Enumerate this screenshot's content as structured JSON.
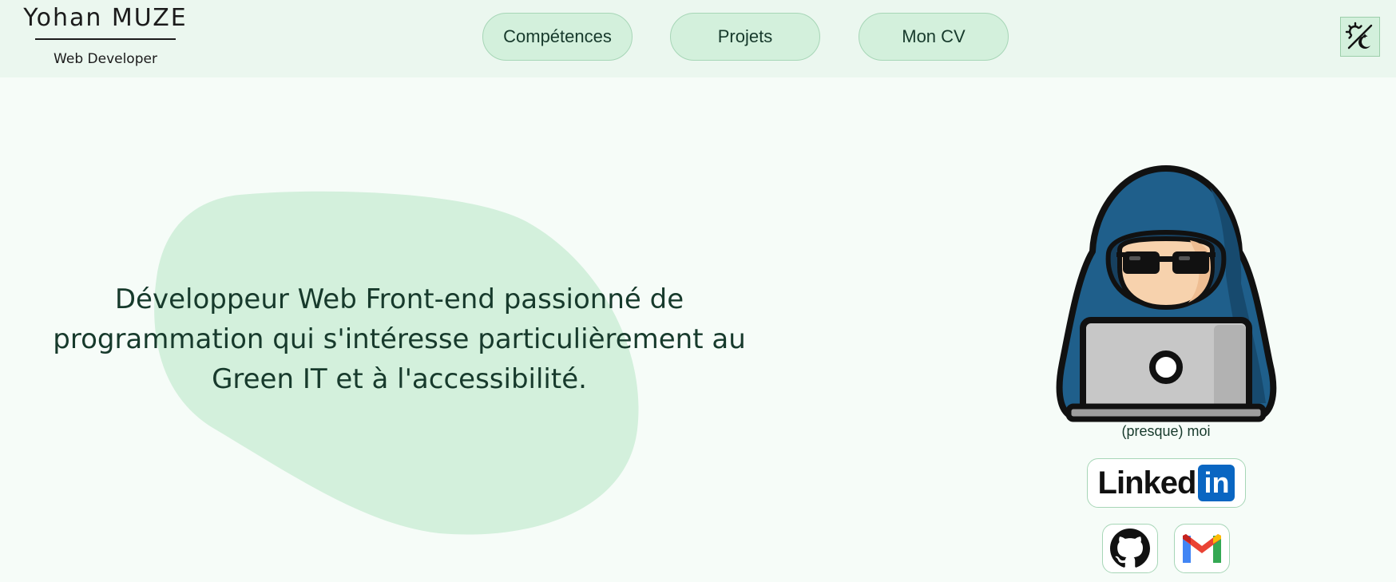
{
  "header": {
    "brand_name": "Yohan MUZE",
    "brand_role": "Web Developer",
    "nav": [
      {
        "label": "Compétences"
      },
      {
        "label": "Projets"
      },
      {
        "label": "Mon CV"
      }
    ],
    "theme_toggle_icon": "sun-moon-icon"
  },
  "hero": {
    "tagline_lines": [
      "Développeur Web Front-end passionné de",
      "programmation qui s'intéresse particulièrement au",
      "Green IT et à l'accessibilité."
    ],
    "avatar_caption": "(presque) moi"
  },
  "social": {
    "linkedin_word": "Linked",
    "linkedin_in": "in",
    "github_icon": "github-icon",
    "gmail_icon": "gmail-icon"
  },
  "colors": {
    "header_bg": "#ebf7ef",
    "page_bg": "#f6fcf8",
    "accent": "#d3f0dc",
    "text": "#173a2c",
    "linkedin_blue": "#0a66c2",
    "gmail_red": "#ea4335"
  }
}
